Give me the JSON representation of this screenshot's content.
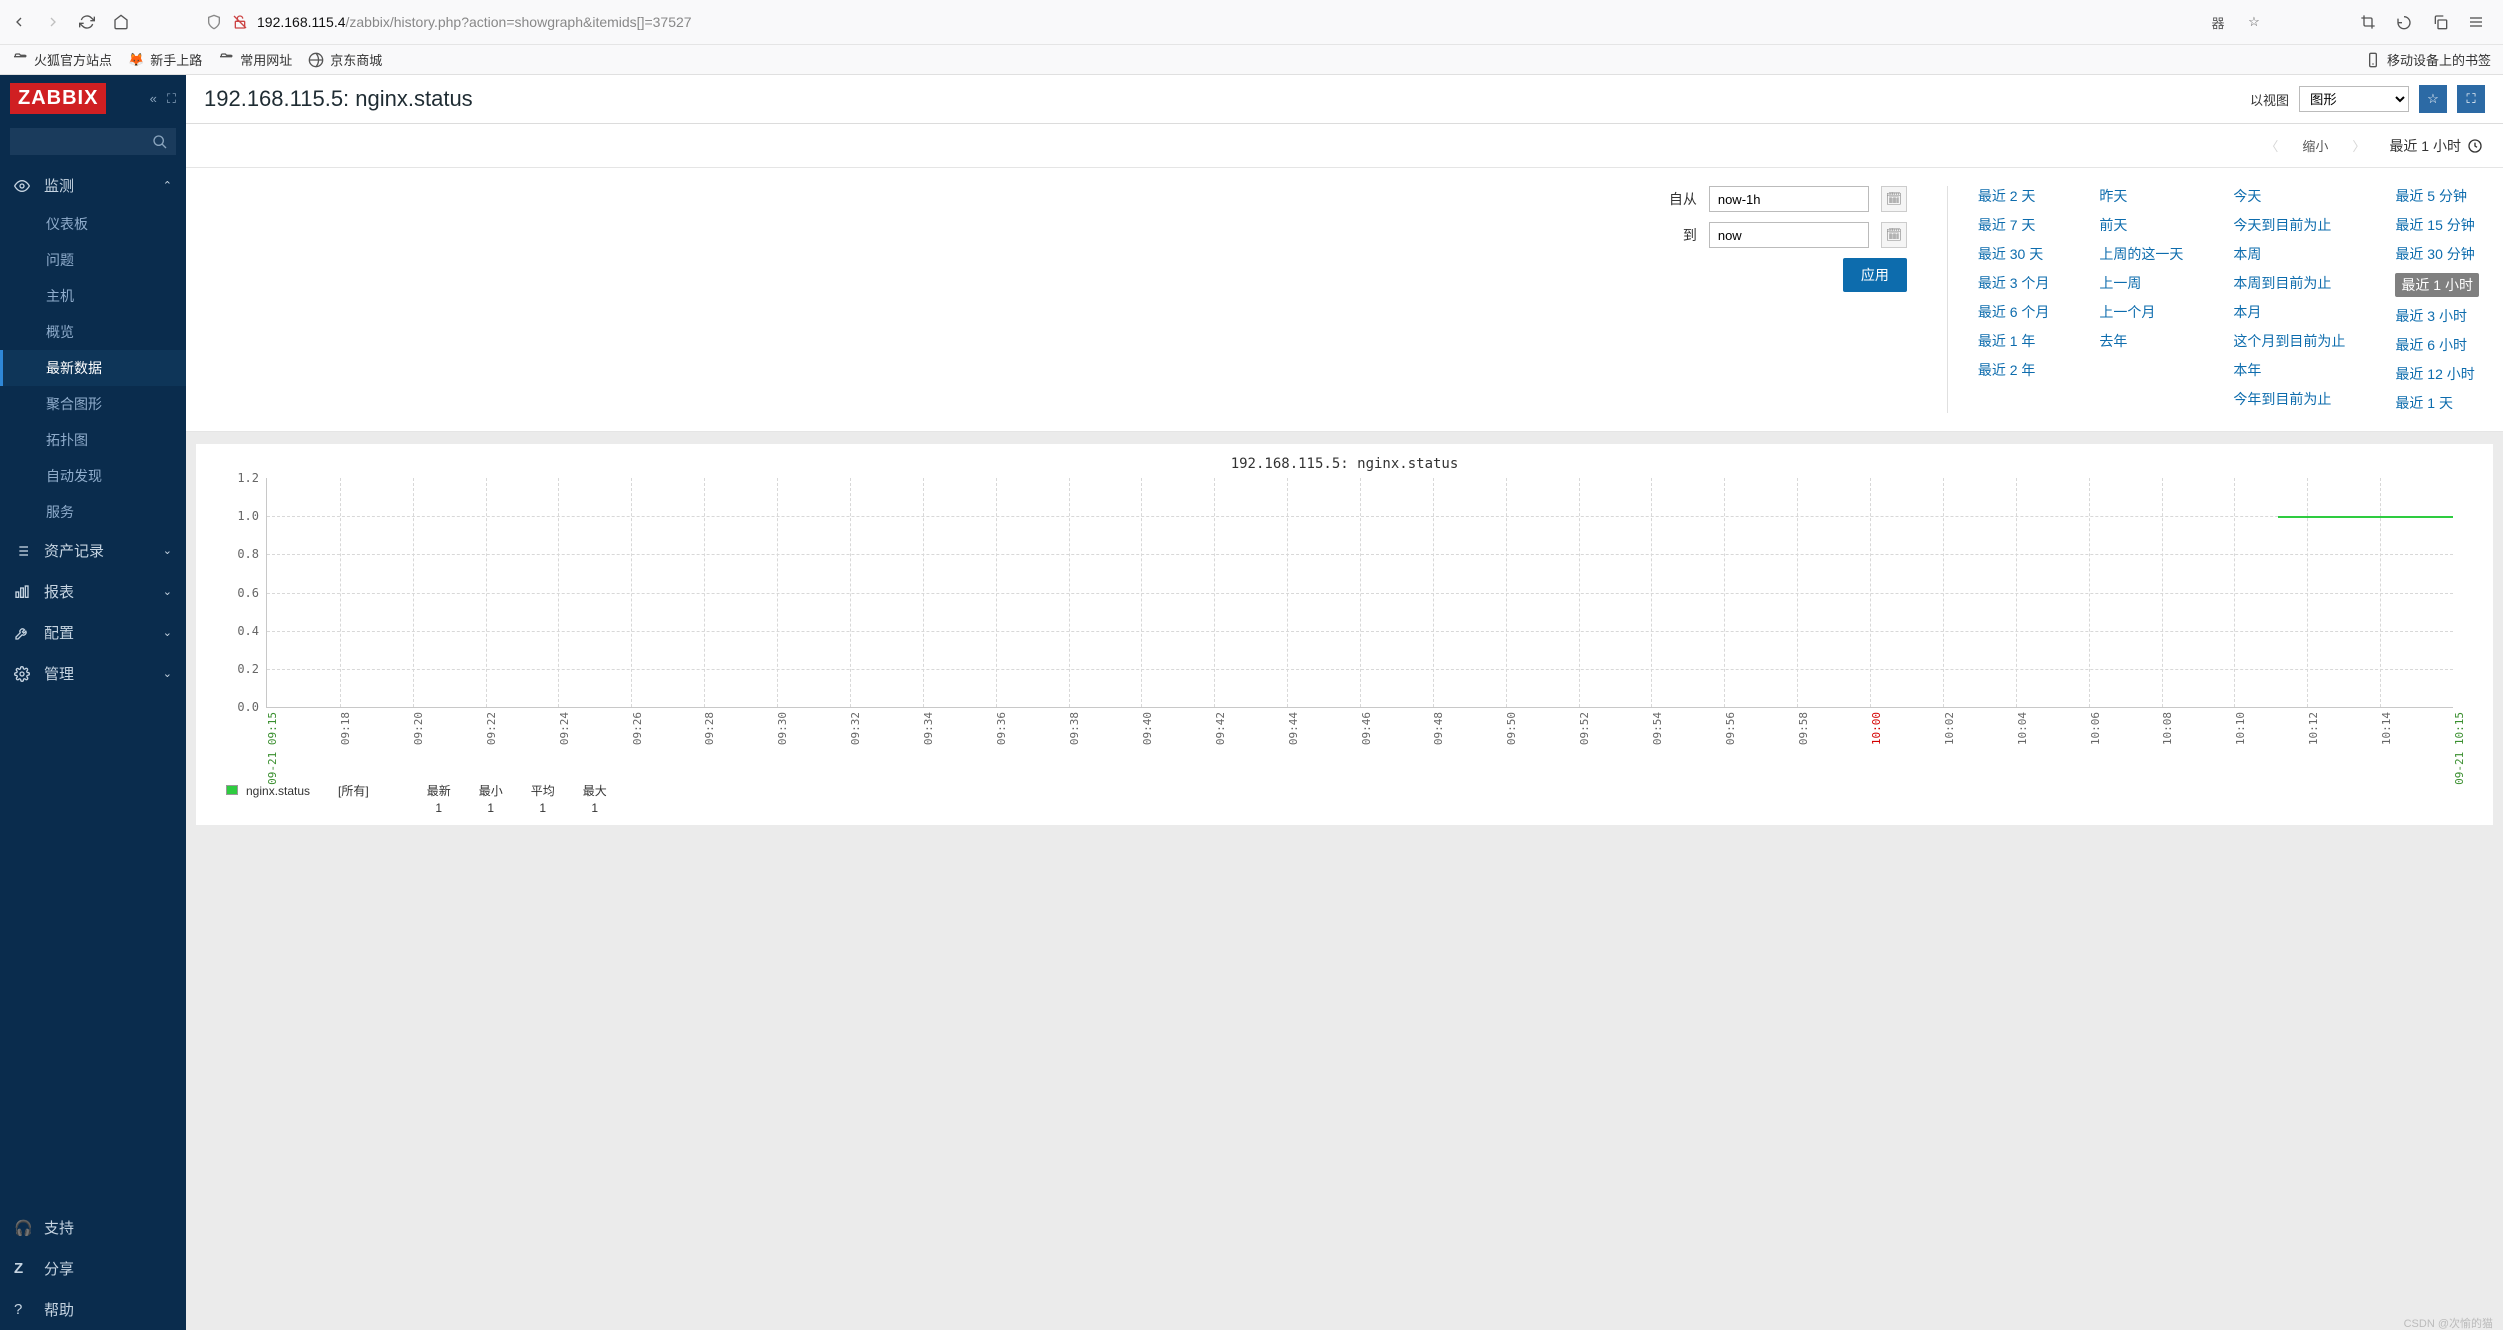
{
  "browser": {
    "url_prefix": "192.168.115.4",
    "url_path": "/zabbix/history.php?action=showgraph&itemids[]=37527",
    "bookmarks": [
      "火狐官方站点",
      "新手上路",
      "常用网址",
      "京东商城"
    ],
    "mobile_bookmarks": "移动设备上的书签"
  },
  "sidebar": {
    "logo": "ZABBIX",
    "search_placeholder": "",
    "sections": {
      "monitoring": {
        "label": "监测",
        "items": [
          "仪表板",
          "问题",
          "主机",
          "概览",
          "最新数据",
          "聚合图形",
          "拓扑图",
          "自动发现",
          "服务"
        ]
      },
      "inventory": {
        "label": "资产记录"
      },
      "reports": {
        "label": "报表"
      },
      "configuration": {
        "label": "配置"
      },
      "administration": {
        "label": "管理"
      }
    },
    "footer": [
      "支持",
      "分享",
      "帮助"
    ]
  },
  "page": {
    "title": "192.168.115.5: nginx.status",
    "view_as_label": "以视图",
    "view_as_value": "图形"
  },
  "timenav": {
    "zoom_out": "缩小",
    "current_range": "最近 1 小时"
  },
  "filter": {
    "from_label": "自从",
    "from_value": "now-1h",
    "to_label": "到",
    "to_value": "now",
    "apply": "应用",
    "presets": {
      "col1": [
        "最近 2 天",
        "最近 7 天",
        "最近 30 天",
        "最近 3 个月",
        "最近 6 个月",
        "最近 1 年",
        "最近 2 年"
      ],
      "col2": [
        "昨天",
        "前天",
        "上周的这一天",
        "上一周",
        "上一个月",
        "去年"
      ],
      "col3": [
        "今天",
        "今天到目前为止",
        "本周",
        "本周到目前为止",
        "本月",
        "这个月到目前为止",
        "本年",
        "今年到目前为止"
      ],
      "col4": [
        "最近 5 分钟",
        "最近 15 分钟",
        "最近 30 分钟",
        "最近 1 小时",
        "最近 3 小时",
        "最近 6 小时",
        "最近 12 小时",
        "最近 1 天"
      ]
    },
    "selected_preset": "最近 1 小时"
  },
  "chart_data": {
    "type": "line",
    "title": "192.168.115.5: nginx.status",
    "ylabel": "",
    "ylim": [
      0,
      1.2
    ],
    "y_ticks": [
      0,
      0.2,
      0.4,
      0.6,
      0.8,
      1.0,
      1.2
    ],
    "x_ticks": [
      "09-21 09:15",
      "09:18",
      "09:20",
      "09:22",
      "09:24",
      "09:26",
      "09:28",
      "09:30",
      "09:32",
      "09:34",
      "09:36",
      "09:38",
      "09:40",
      "09:42",
      "09:44",
      "09:46",
      "09:48",
      "09:50",
      "09:52",
      "09:54",
      "09:56",
      "09:58",
      "10:00",
      "10:02",
      "10:04",
      "10:06",
      "10:08",
      "10:10",
      "10:12",
      "10:14",
      "09-21 10:15"
    ],
    "series": [
      {
        "name": "nginx.status",
        "color": "#2ecc40",
        "data_segment": {
          "from": "10:11",
          "to": "10:15",
          "value": 1
        }
      }
    ],
    "legend": {
      "name": "nginx.status",
      "scope": "[所有]",
      "stats_labels": [
        "最新",
        "最小",
        "平均",
        "最大"
      ],
      "stats_values": [
        "1",
        "1",
        "1",
        "1"
      ]
    }
  },
  "watermark": "CSDN @次愉的猫"
}
